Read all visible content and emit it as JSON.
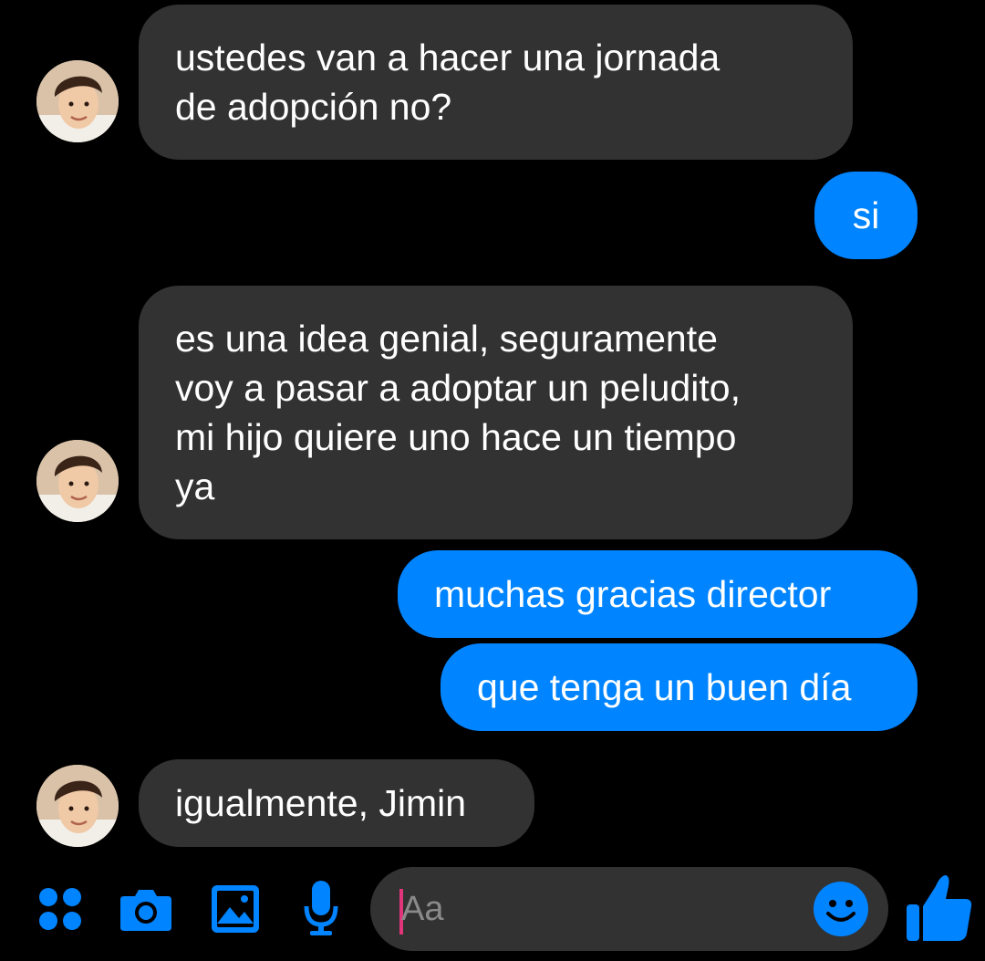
{
  "conversation": {
    "messages": [
      {
        "direction": "in",
        "text": "ustedes van a hacer una jornada\nde adopción no?"
      },
      {
        "direction": "out",
        "text": "si"
      },
      {
        "direction": "in",
        "text": "es una idea genial, seguramente\nvoy a pasar a adoptar un peludito,\nmi hijo quiere uno hace un tiempo\nya"
      },
      {
        "direction": "out",
        "text": "muchas gracias director"
      },
      {
        "direction": "out",
        "text": "que tenga un buen día"
      },
      {
        "direction": "in",
        "text": "igualmente, Jimin"
      }
    ]
  },
  "composer": {
    "placeholder": "Aa",
    "icons": [
      "menu-dots-icon",
      "camera-icon",
      "image-icon",
      "microphone-icon",
      "emoji-icon",
      "thumbs-up-icon"
    ]
  },
  "colors": {
    "background": "#000000",
    "incoming_bubble": "#323232",
    "outgoing_bubble": "#0084ff",
    "accent": "#0084ff",
    "caret": "#e0357a"
  }
}
